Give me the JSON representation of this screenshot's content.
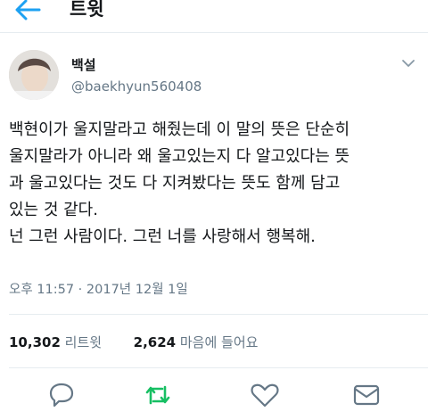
{
  "header": {
    "title": "트윗"
  },
  "user": {
    "name": "백설",
    "handle": "@baekhyun560408"
  },
  "tweet": {
    "lines": [
      "백현이가 울지말라고 해줬는데 이 말의 뜻은 단순히",
      "울지말라가 아니라 왜 울고있는지 다 알고있다는 뜻",
      "과 울고있다는 것도 다 지켜봤다는 뜻도 함께 담고",
      "있는 것 같다.",
      "넌 그런 사람이다. 그런 너를 사랑해서 행복해."
    ]
  },
  "meta": {
    "timestamp": "오후 11:57 · 2017년 12월 1일"
  },
  "stats": {
    "retweet_count": "10,302",
    "retweet_label": "리트윗",
    "like_count": "2,624",
    "like_label": "마음에 들어요"
  },
  "colors": {
    "accent": "#1da1f2",
    "retweet_green": "#17bf63",
    "muted": "#657786"
  },
  "icons": [
    "back-arrow-icon",
    "chevron-down-icon",
    "reply-icon",
    "retweet-icon",
    "like-icon",
    "dm-icon"
  ]
}
